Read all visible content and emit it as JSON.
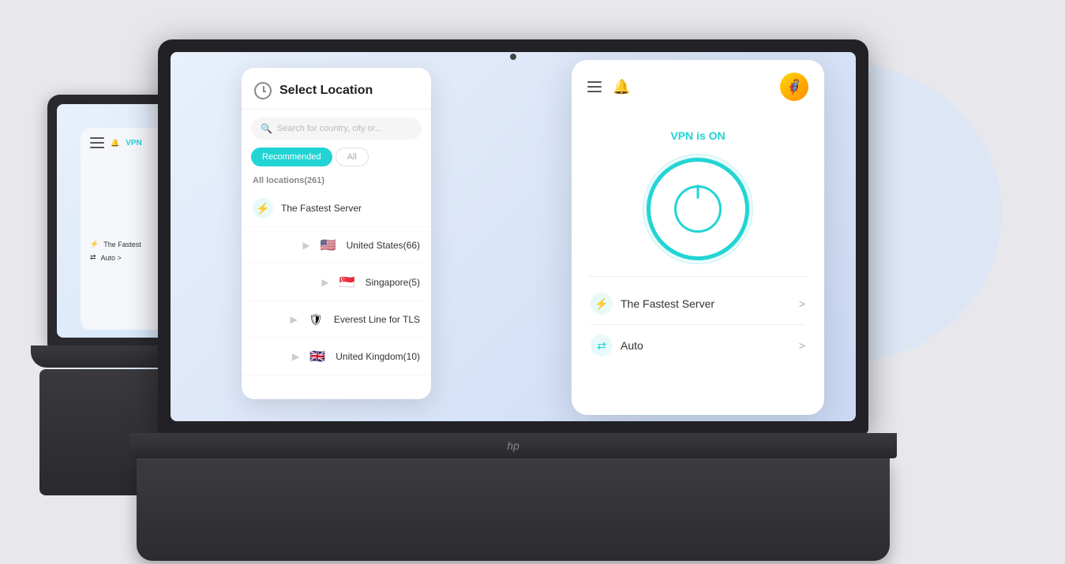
{
  "background": {
    "color": "#e8e8ec"
  },
  "select_panel": {
    "title": "Select Location",
    "search_placeholder": "Search for country, city or...",
    "tab_recommended": "Recommended",
    "tab_all": "All",
    "section_label": "All locations(261)",
    "servers": [
      {
        "name": "The Fastest Server",
        "flag": "⚡",
        "type": "fastest"
      },
      {
        "name": "United States(66)",
        "flag": "🇺🇸",
        "type": "country"
      },
      {
        "name": "Singapore(5)",
        "flag": "🇸🇬",
        "type": "country"
      },
      {
        "name": "Everest Line for TLS",
        "flag": "🛡",
        "type": "special"
      },
      {
        "name": "United Kingdom(10)",
        "flag": "🇬🇧",
        "type": "country"
      }
    ]
  },
  "main_panel": {
    "vpn_status": "VPN is ON",
    "power_button_label": "Power",
    "fastest_server_label": "The Fastest Server",
    "fastest_server_arrow": ">",
    "auto_label": "Auto",
    "auto_arrow": ">"
  },
  "mini_app": {
    "vpn_label": "VPN",
    "fastest_server_label": "The Fastest",
    "auto_label": "Auto >"
  },
  "laptop_brand": "hp"
}
